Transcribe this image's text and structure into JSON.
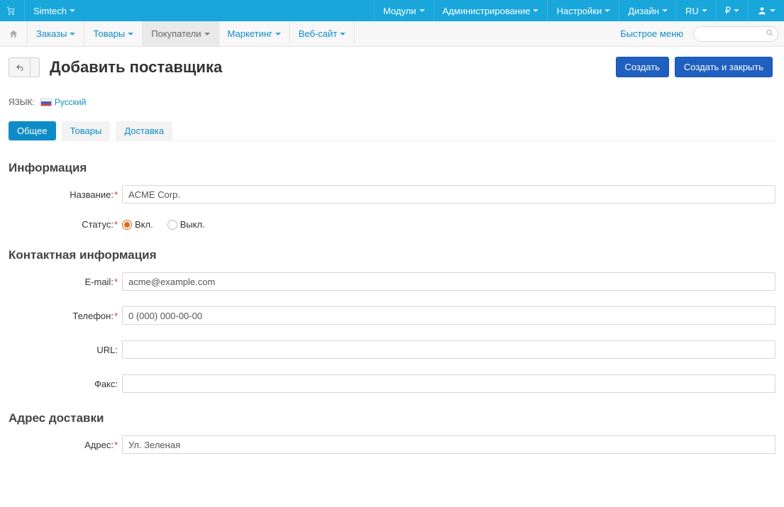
{
  "topbar": {
    "brand": "Simtech",
    "menu": [
      "Модули",
      "Администрирование",
      "Настройки",
      "Дизайн"
    ],
    "lang": "RU",
    "currency": "₽"
  },
  "secnav": {
    "items": [
      {
        "label": "Заказы"
      },
      {
        "label": "Товары"
      },
      {
        "label": "Покупатели",
        "active": true
      },
      {
        "label": "Маркетинг"
      },
      {
        "label": "Веб-сайт"
      }
    ],
    "quick": "Быстрое меню",
    "search_placeholder": ""
  },
  "title": "Добавить поставщика",
  "actions": {
    "create": "Создать",
    "create_close": "Создать и закрыть"
  },
  "language": {
    "label": "ЯЗЫК:",
    "value": "Русский"
  },
  "tabs": [
    "Общее",
    "Товары",
    "Доставка"
  ],
  "active_tab": 0,
  "sections": {
    "info": "Информация",
    "contact": "Контактная информация",
    "ship": "Адрес доставки"
  },
  "fields": {
    "name": {
      "label": "Название:",
      "required": true,
      "value": "ACME Corp."
    },
    "status": {
      "label": "Статус:",
      "required": true,
      "on": "Вкл.",
      "off": "Выкл.",
      "value": "on"
    },
    "email": {
      "label": "E-mail:",
      "required": true,
      "value": "acme@example.com"
    },
    "phone": {
      "label": "Телефон:",
      "required": true,
      "value": "0 (000) 000-00-00"
    },
    "url": {
      "label": "URL:",
      "required": false,
      "value": ""
    },
    "fax": {
      "label": "Факс:",
      "required": false,
      "value": ""
    },
    "address": {
      "label": "Адрес:",
      "required": true,
      "value": "Ул. Зеленая"
    }
  }
}
